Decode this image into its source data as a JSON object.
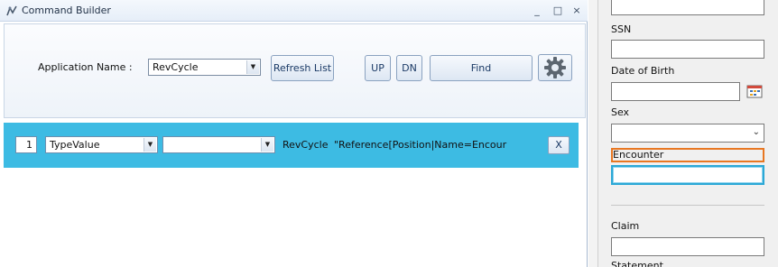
{
  "window": {
    "title": "Command Builder",
    "controls": {
      "minimize": "_",
      "maximize": "□",
      "close": "×"
    }
  },
  "toolbar": {
    "app_name_label": "Application Name :",
    "app_select_value": "RevCycle",
    "refresh_label": "Refresh List",
    "up_label": "UP",
    "dn_label": "DN",
    "find_label": "Find",
    "settings_icon": "gear-icon"
  },
  "command_row": {
    "index": "1",
    "type_value": "TypeValue",
    "attribute_value": "",
    "application": "RevCycle",
    "expression": "\"Reference[Position|Name=Encour",
    "remove_label": "X",
    "highlight_color": "#3dbbe3"
  },
  "form": {
    "ssn_label": "SSN",
    "dob_label": "Date of Birth",
    "sex_label": "Sex",
    "encounter_label": "Encounter",
    "claim_label": "Claim",
    "statement_label": "Statement",
    "encounter_focus_color": "#2ba8d6",
    "encounter_highlight_color": "#e87722"
  }
}
